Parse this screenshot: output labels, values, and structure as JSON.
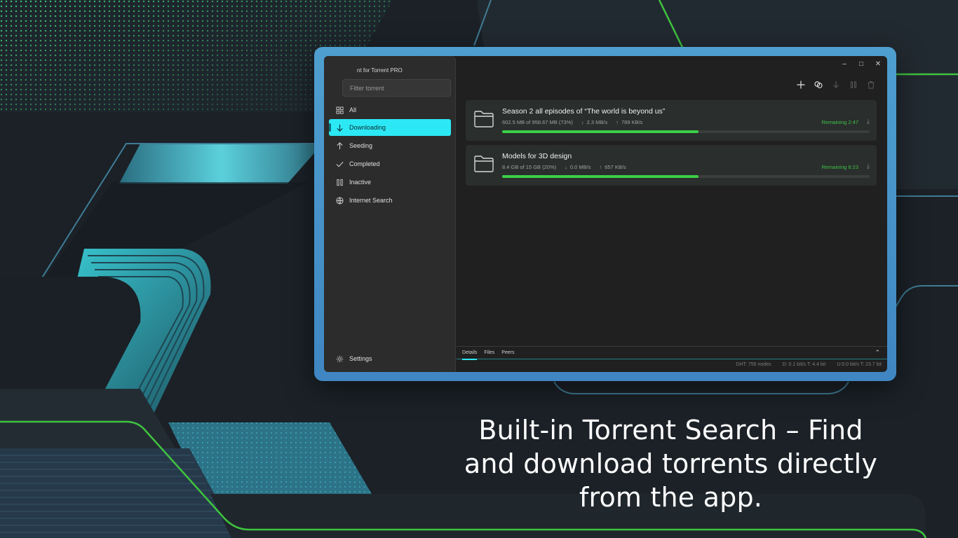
{
  "app": {
    "title": "nt for Torrent PRO",
    "filter_placeholder": "Filter torrent"
  },
  "sidebar": {
    "items": [
      {
        "label": "All",
        "icon": "grid-icon",
        "active": false
      },
      {
        "label": "Downloading",
        "icon": "arrow-down-icon",
        "active": true
      },
      {
        "label": "Seeding",
        "icon": "arrow-up-icon",
        "active": false
      },
      {
        "label": "Completed",
        "icon": "check-icon",
        "active": false
      },
      {
        "label": "Inactive",
        "icon": "pause-icon",
        "active": false
      },
      {
        "label": "Internet Search",
        "icon": "globe-icon",
        "active": false
      }
    ],
    "settings_label": "Settings"
  },
  "window_controls": {
    "minimize": "–",
    "maximize": "□",
    "close": "✕"
  },
  "toolbar": [
    "add-icon",
    "link-icon",
    "download-icon",
    "pause-icon",
    "delete-icon"
  ],
  "torrents": [
    {
      "name": "Season 2 all episodes of “The world is beyond us”",
      "size": "602.5 MB of 958.67 MB  (73%)",
      "down": "2.3 MB/s",
      "up": "789 KB/s",
      "remaining": "Remaining 2:47",
      "progress": 0.535
    },
    {
      "name": "Models for 3D design",
      "size": "8.4 GB of 15 GB  (20%)",
      "down": "0.0 MB/s",
      "up": "657 KB/s",
      "remaining": "Remaining 6:23",
      "progress": 0.535
    }
  ],
  "bottom_tabs": [
    "Details",
    "Files",
    "Peers"
  ],
  "status": {
    "dht": "DHT: 755 nodes",
    "down": "D: 0.1 bit/s T: 4.4 bit",
    "up": "U:0.0 bit/s T: 23.7 bit"
  },
  "caption": {
    "line1": "Built-in Torrent Search – Find",
    "line2": "and download torrents directly",
    "line3": "from the app."
  },
  "colors": {
    "accent": "#2ce8f5",
    "progress": "#3ccf47",
    "remaining": "#3ec24a",
    "frame": "#4596c9"
  }
}
